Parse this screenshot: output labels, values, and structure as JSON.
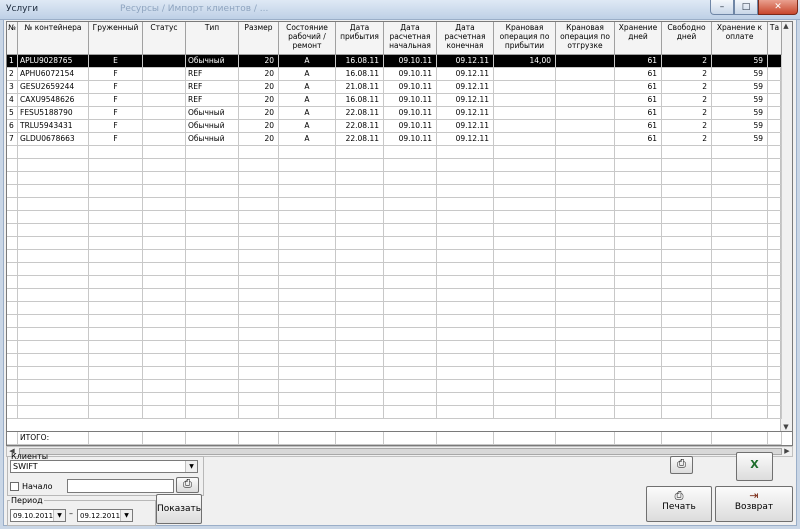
{
  "window": {
    "title": "Услуги",
    "ghost_title": "Ресурсы / Импорт клиентов / ... ",
    "min_glyph": "–",
    "max_glyph": "□",
    "close_glyph": "✕"
  },
  "grid": {
    "columns": [
      {
        "key": "n",
        "label": "№",
        "w": 11
      },
      {
        "key": "cont",
        "label": "№ контейнера",
        "w": 71
      },
      {
        "key": "gr",
        "label": "Груженный",
        "w": 54
      },
      {
        "key": "st",
        "label": "Статус",
        "w": 43
      },
      {
        "key": "type",
        "label": "Тип",
        "w": 53
      },
      {
        "key": "size",
        "label": "Размер",
        "w": 40
      },
      {
        "key": "cond",
        "label": "Состояние рабочий / ремонт",
        "w": 57
      },
      {
        "key": "arr",
        "label": "Дата прибытия",
        "w": 48
      },
      {
        "key": "cs",
        "label": "Дата расчетная начальная",
        "w": 53
      },
      {
        "key": "ce",
        "label": "Дата расчетная конечная",
        "w": 57
      },
      {
        "key": "kra",
        "label": "Крановая операция по прибытии",
        "w": 62
      },
      {
        "key": "kro",
        "label": "Крановая операция по отгрузке",
        "w": 59
      },
      {
        "key": "hd",
        "label": "Хранение дней",
        "w": 47
      },
      {
        "key": "fd",
        "label": "Свободно дней",
        "w": 50
      },
      {
        "key": "hp",
        "label": "Хранение к оплате",
        "w": 56
      },
      {
        "key": "ta",
        "label": "Та",
        "w": 14
      }
    ],
    "rows": [
      {
        "n": "1",
        "cont": "APLU9028765",
        "gr": "E",
        "st": "",
        "type": "Обычный",
        "size": "20",
        "cond": "A",
        "arr": "16.08.11",
        "cs": "09.10.11",
        "ce": "09.12.11",
        "kra": "14,00",
        "kro": "",
        "hd": "61",
        "fd": "2",
        "hp": "59",
        "ta": ""
      },
      {
        "n": "2",
        "cont": "APHU6072154",
        "gr": "F",
        "st": "",
        "type": "REF",
        "size": "20",
        "cond": "A",
        "arr": "16.08.11",
        "cs": "09.10.11",
        "ce": "09.12.11",
        "kra": "",
        "kro": "",
        "hd": "61",
        "fd": "2",
        "hp": "59",
        "ta": ""
      },
      {
        "n": "3",
        "cont": "GESU2659244",
        "gr": "F",
        "st": "",
        "type": "REF",
        "size": "20",
        "cond": "A",
        "arr": "21.08.11",
        "cs": "09.10.11",
        "ce": "09.12.11",
        "kra": "",
        "kro": "",
        "hd": "61",
        "fd": "2",
        "hp": "59",
        "ta": ""
      },
      {
        "n": "4",
        "cont": "CAXU9548626",
        "gr": "F",
        "st": "",
        "type": "REF",
        "size": "20",
        "cond": "A",
        "arr": "16.08.11",
        "cs": "09.10.11",
        "ce": "09.12.11",
        "kra": "",
        "kro": "",
        "hd": "61",
        "fd": "2",
        "hp": "59",
        "ta": ""
      },
      {
        "n": "5",
        "cont": "FESU5188790",
        "gr": "F",
        "st": "",
        "type": "Обычный",
        "size": "20",
        "cond": "A",
        "arr": "22.08.11",
        "cs": "09.10.11",
        "ce": "09.12.11",
        "kra": "",
        "kro": "",
        "hd": "61",
        "fd": "2",
        "hp": "59",
        "ta": ""
      },
      {
        "n": "6",
        "cont": "TRLU5943431",
        "gr": "F",
        "st": "",
        "type": "Обычный",
        "size": "20",
        "cond": "A",
        "arr": "22.08.11",
        "cs": "09.10.11",
        "ce": "09.12.11",
        "kra": "",
        "kro": "",
        "hd": "61",
        "fd": "2",
        "hp": "59",
        "ta": ""
      },
      {
        "n": "7",
        "cont": "GLDU0678663",
        "gr": "F",
        "st": "",
        "type": "Обычный",
        "size": "20",
        "cond": "A",
        "arr": "22.08.11",
        "cs": "09.10.11",
        "ce": "09.12.11",
        "kra": "",
        "kro": "",
        "hd": "61",
        "fd": "2",
        "hp": "59",
        "ta": ""
      }
    ],
    "total_label": "ИТОГО:"
  },
  "clients": {
    "legend": "Клиенты",
    "value": "SWIFT",
    "start_label": "Начало",
    "start_value": ""
  },
  "period": {
    "legend": "Период",
    "from": "09.10.2011",
    "sep": "–",
    "to": "09.12.2011",
    "show_label": "Показать"
  },
  "actions": {
    "print_label": "Печать",
    "back_label": "Возврат"
  },
  "colors": {
    "selection": "#000000",
    "window_bg": "#f0f0f0"
  }
}
